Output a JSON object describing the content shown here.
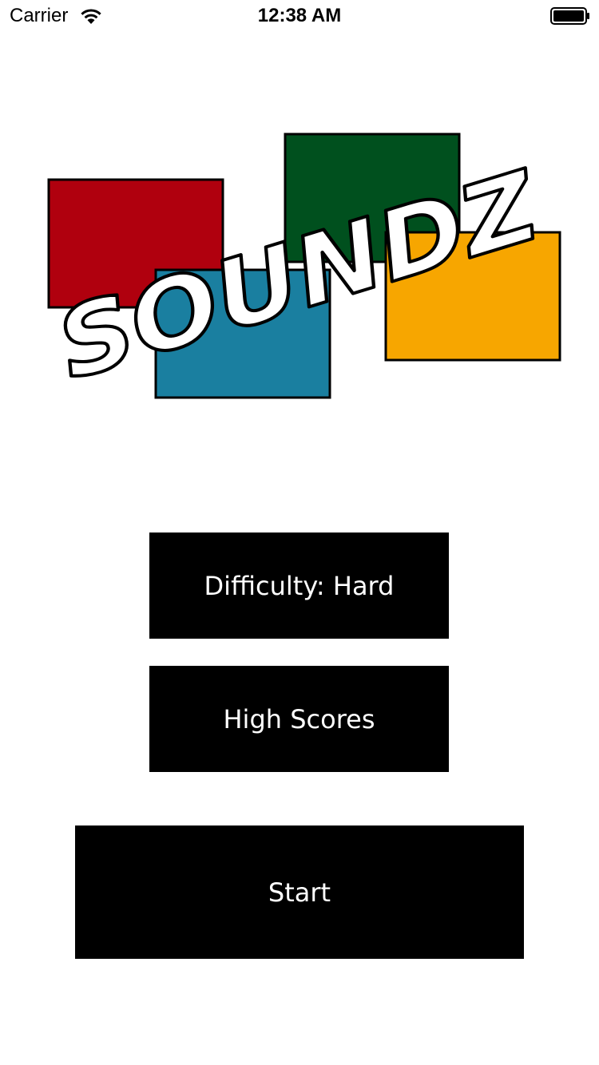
{
  "status_bar": {
    "carrier": "Carrier",
    "time": "12:38 AM",
    "wifi_icon": "wifi-icon",
    "battery_icon": "battery-icon"
  },
  "logo": {
    "text": "SOUNDZ",
    "colors": {
      "red": "#B0000E",
      "blue": "#1A7FA0",
      "green": "#00501E",
      "yellow": "#F7A600"
    }
  },
  "buttons": {
    "difficulty_label": "Difficulty: Hard",
    "high_scores_label": "High Scores",
    "start_label": "Start"
  },
  "theme": {
    "background": "#FFFFFF",
    "button_background": "#000000",
    "button_text": "#FFFFFF"
  }
}
